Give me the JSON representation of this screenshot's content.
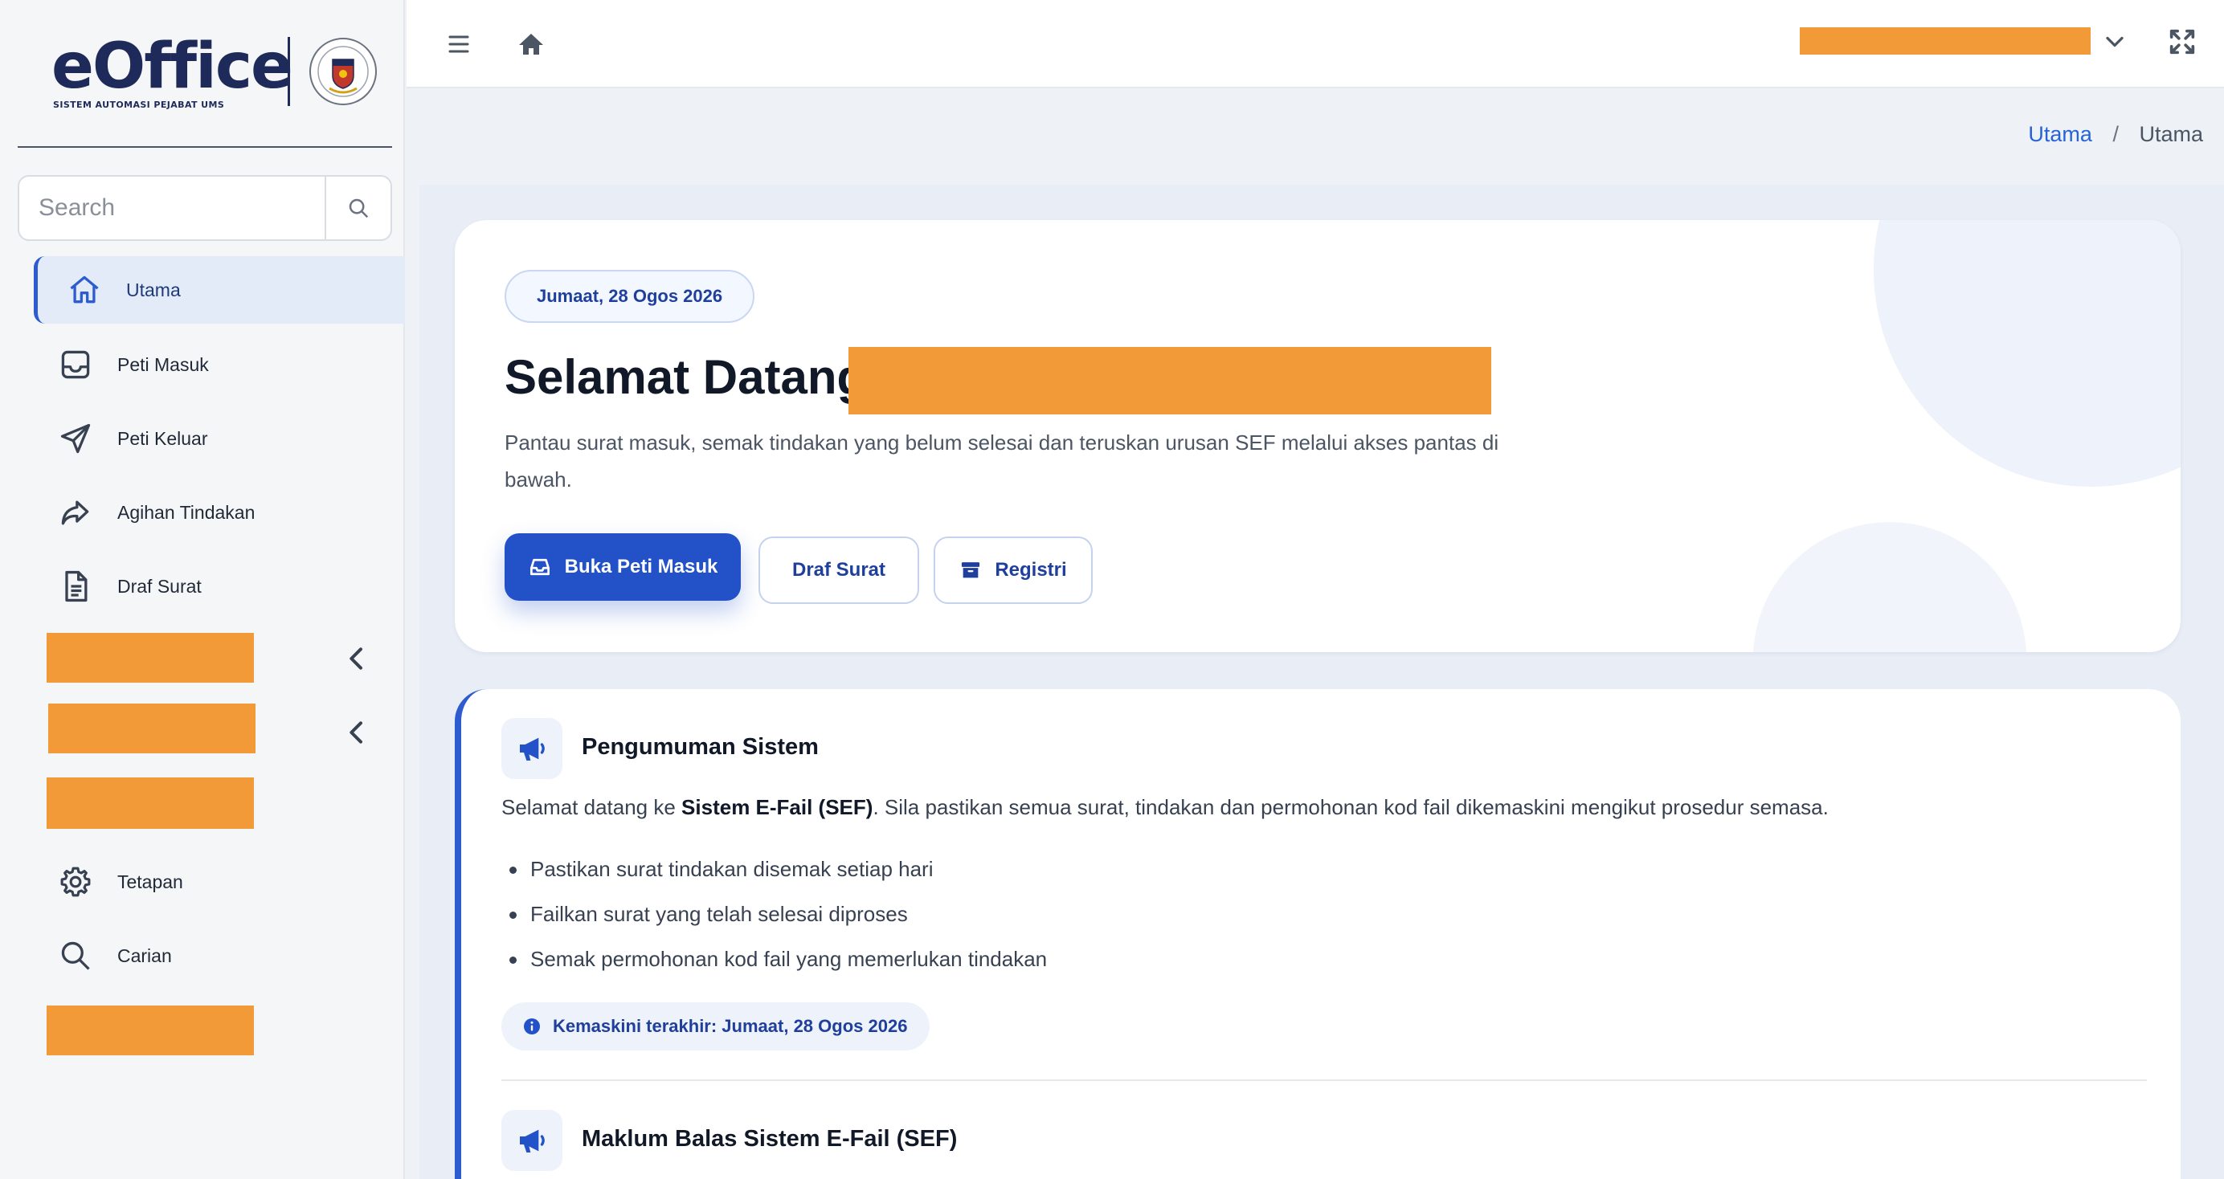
{
  "logo": {
    "name": "eOffice",
    "tagline": "SISTEM AUTOMASI PEJABAT UMS"
  },
  "search": {
    "placeholder": "Search"
  },
  "sidebar": {
    "items": [
      {
        "label": "Utama",
        "icon": "home-icon"
      },
      {
        "label": "Peti Masuk",
        "icon": "inbox-icon"
      },
      {
        "label": "Peti Keluar",
        "icon": "send-icon"
      },
      {
        "label": "Agihan Tindakan",
        "icon": "share-forward-icon"
      },
      {
        "label": "Draf Surat",
        "icon": "document-icon"
      },
      {
        "label": "Tetapan",
        "icon": "gear-icon"
      },
      {
        "label": "Carian",
        "icon": "search-icon"
      }
    ]
  },
  "breadcrumb": {
    "link": "Utama",
    "separator": "/",
    "current": "Utama"
  },
  "hero": {
    "date": "Jumaat, 28 Ogos 2026",
    "greeting": "Selamat Datang,",
    "description": "Pantau surat masuk, semak tindakan yang belum selesai dan teruskan urusan SEF melalui akses pantas di bawah.",
    "buttons": {
      "inbox": "Buka Peti Masuk",
      "draft": "Draf Surat",
      "registry": "Registri"
    }
  },
  "announcement": {
    "title": "Pengumuman Sistem",
    "text_before": "Selamat datang ke ",
    "text_bold": "Sistem E-Fail (SEF)",
    "text_after": ". Sila pastikan semua surat, tindakan dan permohonan kod fail dikemaskini mengikut prosedur semasa.",
    "items": [
      "Pastikan surat tindakan disemak setiap hari",
      "Failkan surat yang telah selesai diproses",
      "Semak permohonan kod fail yang memerlukan tindakan"
    ],
    "updated": "Kemaskini terakhir: Jumaat, 28 Ogos 2026"
  },
  "feedback": {
    "title": "Maklum Balas Sistem E-Fail (SEF)"
  },
  "colors": {
    "accent": "#2352c8",
    "redaction": "#f29a38",
    "sidebar_active_bg": "#e3ebf8"
  }
}
